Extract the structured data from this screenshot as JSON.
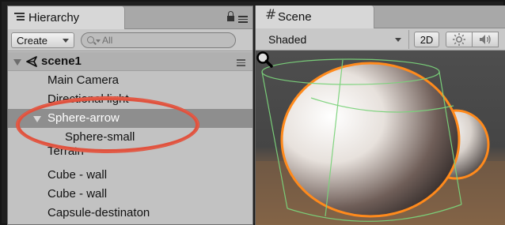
{
  "hierarchy": {
    "tab_label": "Hierarchy",
    "create_label": "Create",
    "search_placeholder": "All",
    "scene_name": "scene1",
    "items": [
      {
        "label": "Main Camera"
      },
      {
        "label": "Directional light"
      },
      {
        "label": "Sphere-arrow"
      },
      {
        "label": "Sphere-small"
      },
      {
        "label": "Terrain"
      },
      {
        "label": "Cube - wall"
      },
      {
        "label": "Cube - wall"
      },
      {
        "label": "Capsule-destinaton"
      }
    ],
    "selected_item": "Sphere-arrow",
    "annotation_color": "#e0523e"
  },
  "scene": {
    "tab_label": "Scene",
    "shading_mode": "Shaded",
    "mode_2d_label": "2D",
    "icons": [
      "hash-icon",
      "sun-icon",
      "speaker-icon",
      "magnifier-icon"
    ],
    "colors": {
      "selection_outline": "#ff8a1c",
      "collider_wireframe": "#7bd37b",
      "ground": "#8a6a4a"
    }
  }
}
